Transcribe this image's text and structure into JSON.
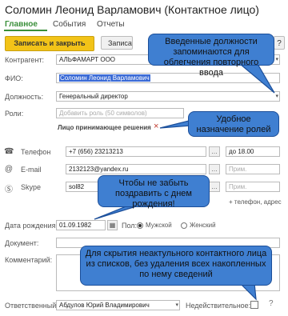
{
  "window": {
    "title": "Соломин Леонид Варламович (Контактное лицо)"
  },
  "tabs": [
    {
      "label": "Главное"
    },
    {
      "label": "События"
    },
    {
      "label": "Отчеты"
    }
  ],
  "toolbar": {
    "save_close": "Записать и закрыть",
    "save": "Записать",
    "help": "?"
  },
  "form": {
    "counterparty_label": "Контрагент:",
    "counterparty_value": "АЛЬФАМАРТ ООО",
    "fio_label": "ФИО:",
    "fio_value": "Соломин Леонид Варламович",
    "position_label": "Должность:",
    "position_value": "Генеральный директор",
    "roles_label": "Роли:",
    "roles_placeholder": "Добавить роль (50 символов)",
    "role_tag": "Лицо принимающее решения",
    "role_remove": "×",
    "phone_label": "Телефон",
    "phone_value": "+7 (656) 23213213",
    "phone_note": "до 18.00",
    "email_label": "E-mail",
    "email_value": "2132123@yandex.ru",
    "email_note_ph": "Прим.",
    "skype_label": "Skype",
    "skype_value": "sol82",
    "skype_note_ph": "Прим.",
    "add_contact": "+ телефон, адрес",
    "dob_label": "Дата рождения:",
    "dob_value": "01.09.1982",
    "gender_label": "Пол:",
    "gender_male": "Мужской",
    "gender_female": "Женский",
    "gender_selected": "male",
    "document_label": "Документ:",
    "comment_label": "Комментарий:",
    "responsible_label": "Ответственный:",
    "responsible_value": "Абдулов Юрий Владимирович",
    "inactive_label": "Недействительное:",
    "inactive_checked": false
  },
  "callouts": {
    "c1": "Введенные должности запоминаются для облегчения повторного ввода",
    "c2": "Удобное назначение ролей",
    "c3": "Чтобы не забыть поздравить с днем рождения!",
    "c4": "Для скрытия неактульного контактного лица из списков, без удаления всех накопленных по нему сведений"
  },
  "colors": {
    "accent_green": "#3a8f3a",
    "callout_blue": "#3f7fd1",
    "primary_yellow": "#f2c318",
    "selection_blue": "#3b6bd6"
  }
}
